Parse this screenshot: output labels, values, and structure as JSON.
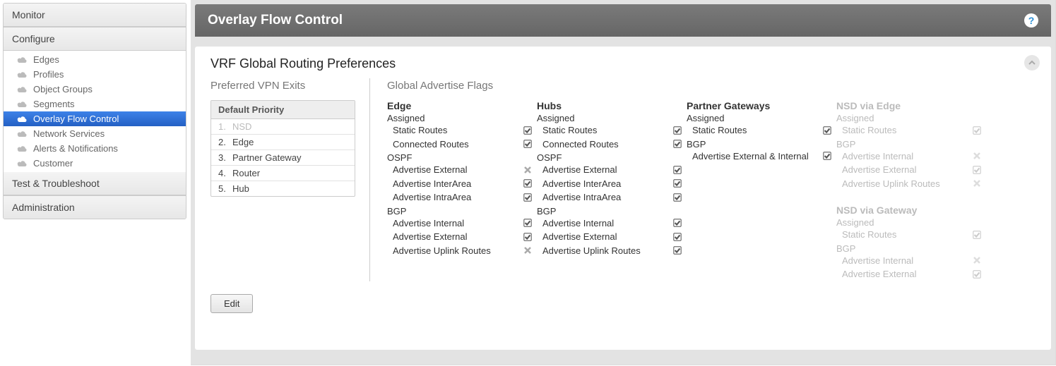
{
  "sidebar": {
    "sections": {
      "monitor": "Monitor",
      "configure": "Configure",
      "test": "Test & Troubleshoot",
      "admin": "Administration"
    },
    "configure_items": [
      {
        "label": "Edges",
        "active": false
      },
      {
        "label": "Profiles",
        "active": false
      },
      {
        "label": "Object Groups",
        "active": false
      },
      {
        "label": "Segments",
        "active": false
      },
      {
        "label": "Overlay Flow Control",
        "active": true
      },
      {
        "label": "Network Services",
        "active": false
      },
      {
        "label": "Alerts & Notifications",
        "active": false
      },
      {
        "label": "Customer",
        "active": false
      }
    ]
  },
  "header": {
    "title": "Overlay Flow Control"
  },
  "panel": {
    "title": "VRF Global Routing Preferences",
    "edit_label": "Edit",
    "vpn_exits": {
      "heading": "Preferred VPN Exits",
      "col_header": "Default Priority",
      "rows": [
        {
          "n": "1.",
          "label": "NSD",
          "muted": true
        },
        {
          "n": "2.",
          "label": "Edge",
          "muted": false
        },
        {
          "n": "3.",
          "label": "Partner Gateway",
          "muted": false
        },
        {
          "n": "4.",
          "label": "Router",
          "muted": false
        },
        {
          "n": "5.",
          "label": "Hub",
          "muted": false
        }
      ]
    },
    "flags": {
      "heading": "Global Advertise Flags",
      "columns": [
        {
          "title": "Edge",
          "faded": false,
          "groups": [
            {
              "label": "Assigned",
              "items": [
                {
                  "name": "Static Routes",
                  "state": "check"
                },
                {
                  "name": "Connected Routes",
                  "state": "check"
                }
              ]
            },
            {
              "label": "OSPF",
              "items": [
                {
                  "name": "Advertise External",
                  "state": "x"
                },
                {
                  "name": "Advertise InterArea",
                  "state": "check"
                },
                {
                  "name": "Advertise IntraArea",
                  "state": "check"
                }
              ]
            },
            {
              "label": "BGP",
              "items": [
                {
                  "name": "Advertise Internal",
                  "state": "check"
                },
                {
                  "name": "Advertise External",
                  "state": "check"
                },
                {
                  "name": "Advertise Uplink Routes",
                  "state": "x"
                }
              ]
            }
          ]
        },
        {
          "title": "Hubs",
          "faded": false,
          "groups": [
            {
              "label": "Assigned",
              "items": [
                {
                  "name": "Static Routes",
                  "state": "check"
                },
                {
                  "name": "Connected Routes",
                  "state": "check"
                }
              ]
            },
            {
              "label": "OSPF",
              "items": [
                {
                  "name": "Advertise External",
                  "state": "check"
                },
                {
                  "name": "Advertise InterArea",
                  "state": "check"
                },
                {
                  "name": "Advertise IntraArea",
                  "state": "check"
                }
              ]
            },
            {
              "label": "BGP",
              "items": [
                {
                  "name": "Advertise Internal",
                  "state": "check"
                },
                {
                  "name": "Advertise External",
                  "state": "check"
                },
                {
                  "name": "Advertise Uplink Routes",
                  "state": "check"
                }
              ]
            }
          ]
        },
        {
          "title": "Partner Gateways",
          "faded": false,
          "groups": [
            {
              "label": "Assigned",
              "items": [
                {
                  "name": "Static Routes",
                  "state": "check"
                }
              ]
            },
            {
              "label": "BGP",
              "items": [
                {
                  "name": "Advertise External & Internal",
                  "state": "check"
                }
              ]
            }
          ]
        },
        {
          "title": "NSD via Edge",
          "faded": true,
          "groups": [
            {
              "label": "Assigned",
              "items": [
                {
                  "name": "Static Routes",
                  "state": "check"
                }
              ]
            },
            {
              "label": "BGP",
              "items": [
                {
                  "name": "Advertise Internal",
                  "state": "x"
                },
                {
                  "name": "Advertise External",
                  "state": "check"
                },
                {
                  "name": "Advertise Uplink Routes",
                  "state": "x"
                }
              ]
            }
          ],
          "second": {
            "title": "NSD via Gateway",
            "groups": [
              {
                "label": "Assigned",
                "items": [
                  {
                    "name": "Static Routes",
                    "state": "check"
                  }
                ]
              },
              {
                "label": "BGP",
                "items": [
                  {
                    "name": "Advertise Internal",
                    "state": "x"
                  },
                  {
                    "name": "Advertise External",
                    "state": "check"
                  }
                ]
              }
            ]
          }
        }
      ]
    }
  }
}
